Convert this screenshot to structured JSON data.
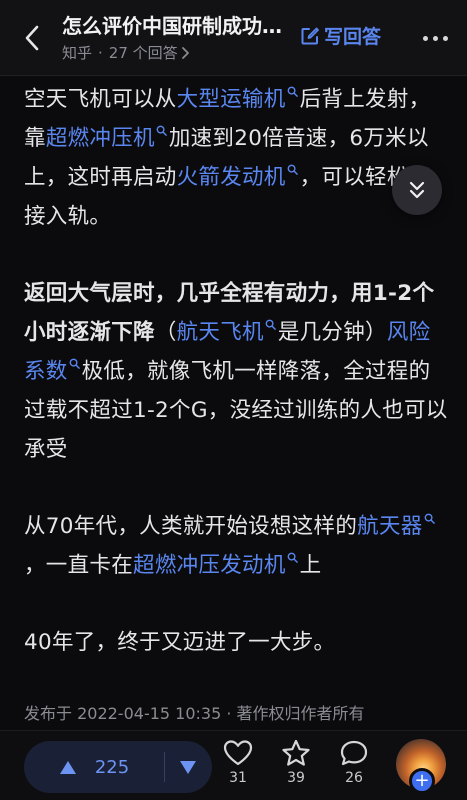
{
  "header": {
    "title": "怎么评价中国研制成功世界首型空天飞机？",
    "source": "知乎",
    "separator": "·",
    "answer_count": "27 个回答",
    "write_answer": "写回答"
  },
  "content": {
    "p1": {
      "t1": "空天飞机可以从",
      "l1": "大型运输机",
      "t2": "后背上发射，靠",
      "l2": "超燃冲压机",
      "t3": "加速到20倍音速，6万米以上，这时再启动",
      "l3": "火箭发动机",
      "t4": "，可以轻松直接入轨。"
    },
    "p2": {
      "t1": "返回大气层时，几乎全程有动力，用1-2个小时逐渐下降",
      "t2": "（",
      "l1": "航天飞机",
      "t3": "是几分钟）",
      "l2": "风险系数",
      "t4": "极低，就像飞机一样降落，全过程的过载不超过1-2个G，没经过训练的人也可以承受"
    },
    "p3": {
      "t1": "从70年代，人类就开始设想这样的",
      "l1": "航天器",
      "t2": "，一直卡在",
      "l2": "超燃冲压发动机",
      "t3": "上"
    },
    "p4": {
      "t1": "40年了，终于又迈进了一大步。"
    },
    "meta": "发布于 2022-04-15 10:35 · 著作权归作者所有"
  },
  "bottom_bar": {
    "upvote_count": "225",
    "like_count": "31",
    "favorite_count": "39",
    "comment_count": "26",
    "avatar_plus": "+"
  },
  "colors": {
    "link": "#5a86f0",
    "background": "#0b0b0d",
    "vote_bg": "#1a2136"
  }
}
